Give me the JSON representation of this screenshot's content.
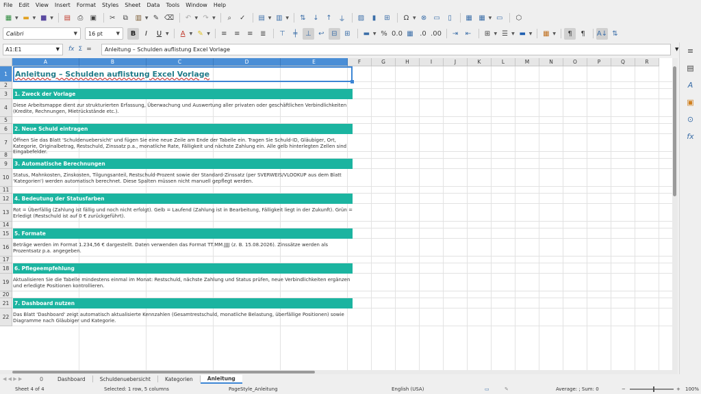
{
  "menu": [
    "File",
    "Edit",
    "View",
    "Insert",
    "Format",
    "Styles",
    "Sheet",
    "Data",
    "Tools",
    "Window",
    "Help"
  ],
  "font_name": "Calibri",
  "font_size": "16 pt",
  "name_box": "A1:E1",
  "formula": "Anleitung – Schulden auflistung Excel Vorlage",
  "columns": [
    "A",
    "B",
    "C",
    "D",
    "E",
    "F",
    "G",
    "H",
    "I",
    "J",
    "K",
    "L",
    "M",
    "N",
    "O",
    "P",
    "Q",
    "R"
  ],
  "rows": [
    "1",
    "2",
    "3",
    "4",
    "5",
    "6",
    "7",
    "8",
    "9",
    "10",
    "11",
    "12",
    "13",
    "14",
    "15",
    "16",
    "17",
    "18",
    "19",
    "20",
    "21",
    "22"
  ],
  "title": "Anleitung – Schulden auflistung Excel Vorlage",
  "sections": [
    {
      "heading": "1. Zweck der Vorlage",
      "text": "Diese Arbeitsmappe dient zur strukturierten Erfassung, Überwachung und Auswertung aller privaten oder geschäftlichen Verbindlichkeiten (Kredite, Rechnungen, Mietrückstände etc.)."
    },
    {
      "heading": "2. Neue Schuld eintragen",
      "text": "Öffnen Sie das Blatt 'Schuldenuebersicht' und fügen Sie eine neue Zeile am Ende der Tabelle ein. Tragen Sie Schuld-ID, Gläubiger, Ort, Kategorie, Originalbetrag, Restschuld, Zinssatz p.a., monatliche Rate, Fälligkeit und nächste Zahlung ein. Alle gelb hinterlegten Zellen sind Eingabefelder."
    },
    {
      "heading": "3. Automatische Berechnungen",
      "text": "Status, Mahnkosten, Zinskosten, Tilgungsanteil, Restschuld-Prozent sowie der Standard-Zinssatz (per SVERWEIS/VLOOKUP aus dem Blatt 'Kategorien') werden automatisch berechnet. Diese Spalten müssen nicht manuell gepflegt werden."
    },
    {
      "heading": "4. Bedeutung der Statusfarben",
      "text": "Rot = Überfällig (Zahlung ist fällig und noch nicht erfolgt). Gelb = Laufend (Zahlung ist in Bearbeitung, Fälligkeit liegt in der Zukunft). Grün = Erledigt (Restschuld ist auf 0 € zurückgeführt)."
    },
    {
      "heading": "5. Formate",
      "text": "Beträge werden im Format 1.234,56 € dargestellt. Daten verwenden das Format TT.MM.JJJJ (z. B. 15.08.2026). Zinssätze werden als Prozentsatz p.a. angegeben."
    },
    {
      "heading": "6. Pflegeempfehlung",
      "text": "Aktualisieren Sie die Tabelle mindestens einmal im Monat: Restschuld, nächste Zahlung und Status prüfen, neue Verbindlichkeiten ergänzen und erledigte Positionen kontrollieren."
    },
    {
      "heading": "7. Dashboard nutzen",
      "text": "Das Blatt 'Dashboard' zeigt automatisch aktualisierte Kennzahlen (Gesamtrestschuld, monatliche Belastung, überfällige Positionen) sowie Diagramme nach Gläubiger und Kategorie."
    }
  ],
  "sheet_tabs": [
    "Dashboard",
    "Schuldenuebersicht",
    "Kategorien",
    "Anleitung"
  ],
  "active_tab": "Anleitung",
  "status": {
    "sheet": "Sheet 4 of 4",
    "selection": "Selected: 1 row, 5 columns",
    "pagestyle": "PageStyle_Anleitung",
    "language": "English (USA)",
    "sum": "Average: ; Sum: 0",
    "zoom": "100%"
  },
  "tab_add": "0"
}
